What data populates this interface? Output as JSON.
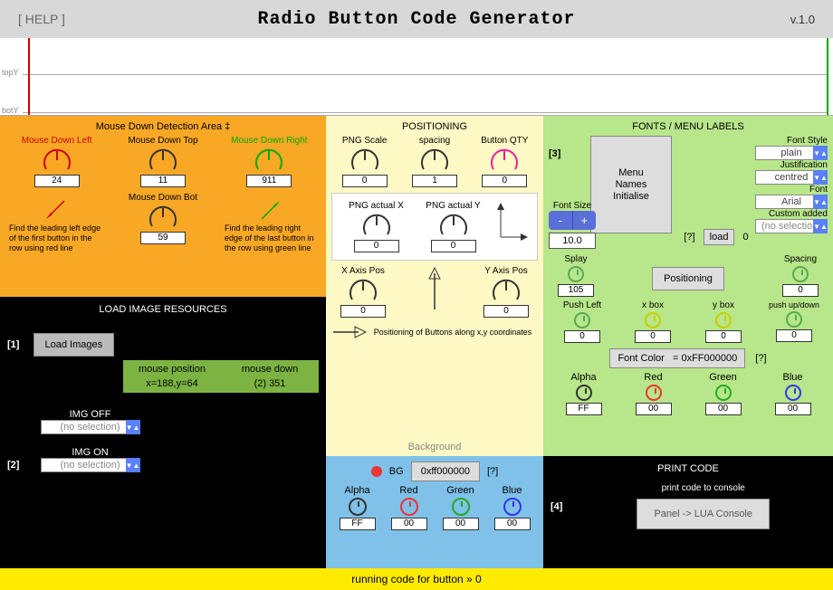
{
  "header": {
    "help": "[ HELP ]",
    "title": "Radio Button Code Generator",
    "version": "v.1.0"
  },
  "ruler": {
    "topY": "topY",
    "botY": "botY"
  },
  "orange": {
    "title": "Mouse Down Detection Area ‡",
    "left": {
      "label": "Mouse Down Left",
      "value": "24"
    },
    "top": {
      "label": "Mouse Down Top",
      "value": "11"
    },
    "right": {
      "label": "Mouse Down Right",
      "value": "911"
    },
    "bot": {
      "label": "Mouse Down Bot",
      "value": "59"
    },
    "hint_left": "Find the leading left edge of the first button in the row using red line",
    "hint_right": "Find the leading right edge of the last button in the row using green line"
  },
  "load": {
    "title": "LOAD IMAGE RESOURCES",
    "step1": "[1]",
    "load_btn": "Load Images",
    "mouse_down_label": "mouse down",
    "mouse_down_val": "(2) 351",
    "mouse_pos_label": "mouse position",
    "mouse_pos_val": "x=188,y=64",
    "step2": "[2]",
    "img_off": "IMG OFF",
    "img_on": "IMG ON",
    "no_selection": "(no selection)"
  },
  "pos": {
    "title": "POSITIONING",
    "png_scale": {
      "label": "PNG Scale",
      "value": "0"
    },
    "spacing": {
      "label": "spacing",
      "value": "1"
    },
    "qty": {
      "label": "Button QTY",
      "value": "0"
    },
    "actual_x": {
      "label": "PNG actual X",
      "value": "0"
    },
    "actual_y": {
      "label": "PNG actual Y",
      "value": "0"
    },
    "x_axis": {
      "label": "X Axis Pos",
      "value": "0"
    },
    "y_axis": {
      "label": "Y Axis Pos",
      "value": "0"
    },
    "hint": "Positioning of Buttons along x,y coordinates"
  },
  "bg": {
    "title": "Background",
    "bg_label": "BG",
    "bg_value": "0xff000000",
    "q": "[?]",
    "alpha": {
      "label": "Alpha",
      "value": "FF"
    },
    "red": {
      "label": "Red",
      "value": "00"
    },
    "green": {
      "label": "Green",
      "value": "00"
    },
    "blue": {
      "label": "Blue",
      "value": "00"
    }
  },
  "fonts": {
    "title": "FONTS / MENU LABELS",
    "step3": "[3]",
    "menu_init": "Menu Names Initialise",
    "font_style_label": "Font Style",
    "font_style": "plain",
    "justification_label": "Justification",
    "justification": "centred",
    "font_label": "Font",
    "font": "Arial",
    "custom_label": "Custom added",
    "custom": "(no selection)",
    "font_size_label": "Font Size",
    "font_size": "10.0",
    "q": "[?]",
    "load_btn": "load",
    "load_val": "0",
    "splay": {
      "label": "Splay",
      "value": "105"
    },
    "positioning_btn": "Positioning",
    "spacing": {
      "label": "Spacing",
      "value": "0"
    },
    "push_left": {
      "label": "Push Left",
      "value": "0"
    },
    "x_box": {
      "label": "x box",
      "value": "0"
    },
    "y_box": {
      "label": "y box",
      "value": "0"
    },
    "push_ud": {
      "label": "push up/down",
      "value": "0"
    },
    "font_color_label": "Font Color",
    "font_color_val": "= 0xFF000000",
    "alpha": {
      "label": "Alpha",
      "value": "FF"
    },
    "red": {
      "label": "Red",
      "value": "00"
    },
    "green": {
      "label": "Green",
      "value": "00"
    },
    "blue": {
      "label": "Blue",
      "value": "00"
    }
  },
  "print": {
    "title": "PRINT CODE",
    "step4": "[4]",
    "hint": "print code to console",
    "btn": "Panel -> LUA Console"
  },
  "footer": "running code for button »   0"
}
